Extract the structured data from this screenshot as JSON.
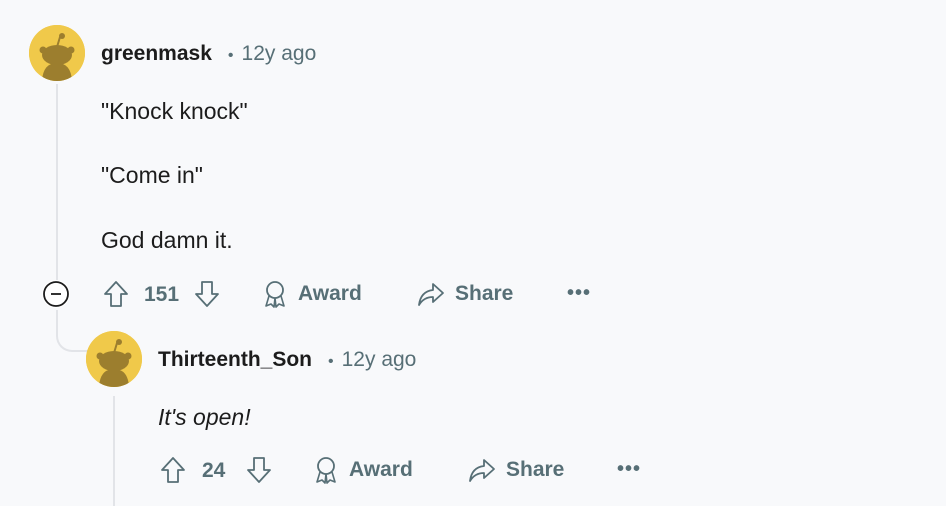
{
  "comments": [
    {
      "username": "greenmask",
      "separator": "•",
      "time": "12y ago",
      "paragraphs": [
        "\"Knock knock\"",
        "\"Come in\"",
        "God damn it."
      ],
      "votes": "151",
      "award_label": "Award",
      "share_label": "Share",
      "more_label": "•••",
      "avatar_icon": "snoo-avatar-icon"
    },
    {
      "username": "Thirteenth_Son",
      "separator": "•",
      "time": "12y ago",
      "paragraphs": [
        "It's open!"
      ],
      "votes": "24",
      "award_label": "Award",
      "share_label": "Share",
      "more_label": "•••",
      "avatar_icon": "snoo-avatar-icon"
    }
  ],
  "colors": {
    "avatar_bg": "#f0c94a",
    "avatar_fg": "#9c7e2e",
    "muted_text": "#576f76",
    "thread_line": "#e2e4e8",
    "background": "#f8f9fb"
  },
  "icons": [
    "upvote-icon",
    "downvote-icon",
    "award-icon",
    "share-icon",
    "collapse-minus-icon"
  ]
}
